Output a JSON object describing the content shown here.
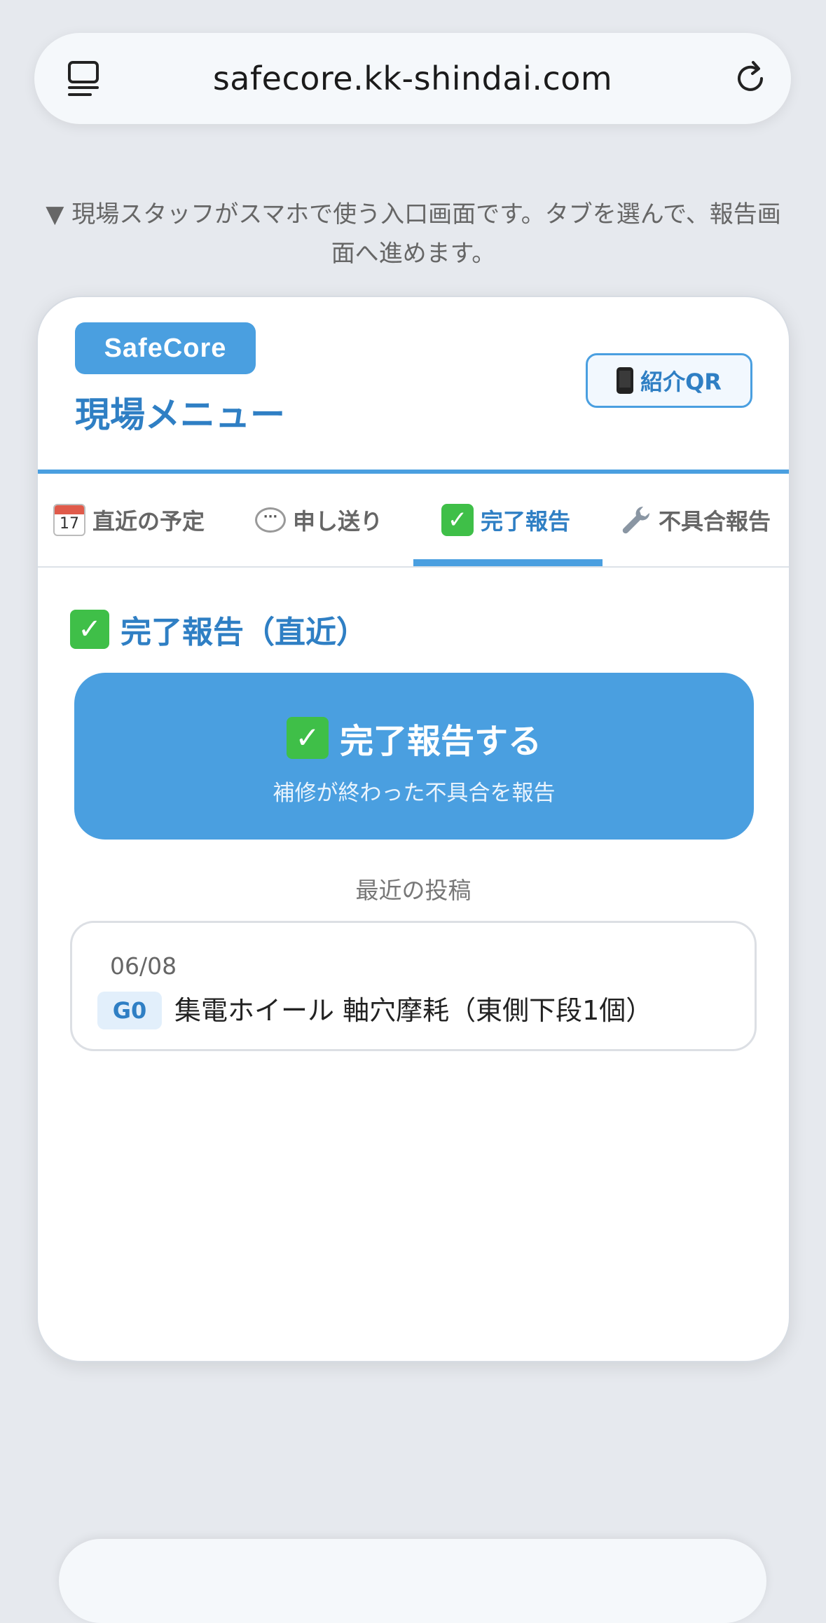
{
  "browser": {
    "url": "safecore.kk-shindai.com",
    "tabs_icon": "tabs-icon",
    "reload_icon": "reload-icon"
  },
  "caption": "▼ 現場スタッフがスマホで使う入口画面です。タブを選んで、報告画面へ進めます。",
  "header": {
    "brand": "SafeCore",
    "title": "現場メニュー",
    "qr_button": "紹介QR"
  },
  "tabs": [
    {
      "label": "直近の予定",
      "icon": "calendar-icon",
      "icon_text": "17"
    },
    {
      "label": "申し送り",
      "icon": "speech-bubble-icon"
    },
    {
      "label": "完了報告",
      "icon": "check-icon",
      "active": true
    },
    {
      "label": "不具合報告",
      "icon": "wrench-icon"
    }
  ],
  "section": {
    "title": "完了報告（直近）",
    "cta_label": "完了報告する",
    "cta_sub": "補修が終わった不具合を報告",
    "recent_label": "最近の投稿"
  },
  "posts": [
    {
      "date": "06/08",
      "tag": "G0",
      "text": "集電ホイール 軸穴摩耗（東側下段1個）"
    }
  ],
  "colors": {
    "accent": "#4a9fe0",
    "accent_dark": "#2f7fc4",
    "check_green": "#3fbf48"
  }
}
